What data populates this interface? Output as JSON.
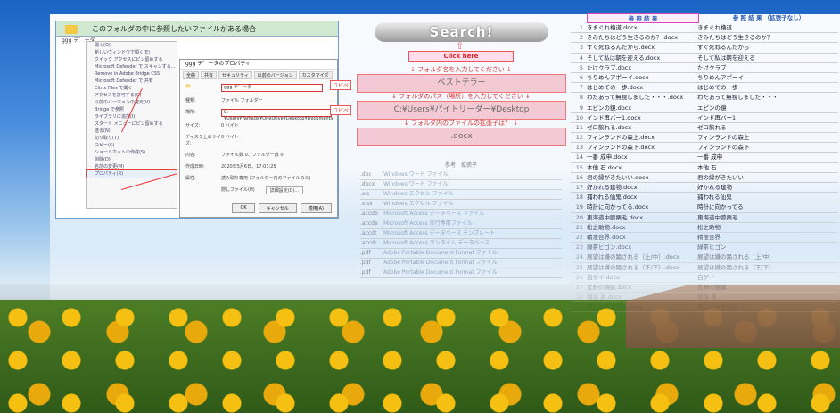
{
  "explorer": {
    "header": "このフォルダの中に参照したいファイルがある場合",
    "folder_label": "ggg テ゛ータ",
    "context_menu": [
      "開く(O)",
      "新しいウィンドウで開く(E)",
      "クイック アクセスにピン留めする",
      "Microsoft Defender で スキャンする...",
      "Remove in Adobe Bridge CS5",
      "Microsoft Defender で 共有",
      "Citrix Files で開く",
      "アクセスを許可する(G)",
      "以前のバージョンの復元(V)",
      "Bridge で参照",
      "ライブラリに追加(I)",
      "スタート メニューにピン留めする",
      "送る(N)",
      "切り取り(T)",
      "コピー(C)",
      "ショートカットの作成(S)",
      "削除(D)",
      "名前の変更(M)",
      "プロパティ(R)"
    ],
    "props_title": "ggg テ゛ータのプロパティ",
    "props_tabs": [
      "全般",
      "共有",
      "セキュリティ",
      "以前のバージョン",
      "カスタマイズ"
    ],
    "props_name": "ggg テ゛ータ",
    "props_rows": [
      {
        "k": "種類:",
        "v": "ファイル フォルダー"
      },
      {
        "k": "場所:",
        "v": "C:¥Users¥Yamada¥OneDrive¥Desktop¥Documents"
      },
      {
        "k": "サイズ:",
        "v": "0 バイト"
      },
      {
        "k": "ディスク上のサイズ:",
        "v": "0 バイト"
      },
      {
        "k": "内容:",
        "v": "ファイル数 0、フォルダー数 0"
      },
      {
        "k": "作成日時:",
        "v": "2020年5月6日、17:03:25"
      },
      {
        "k": "属性:",
        "v": "読み取り専用 (フォルダー内のファイルのみ)"
      }
    ],
    "props_hidden": "隠しファイル(H)",
    "props_detail": "詳細設定(D)...",
    "props_buttons": [
      "OK",
      "キャンセル",
      "適用(A)"
    ]
  },
  "center": {
    "search_label": "Search!",
    "click_here": "Click here",
    "hint1": "↓ フォルダ名を入力してください ↓",
    "input1": "ベストテラー",
    "hint2": "↓ フォルダのパス（場所）を入力してください ↓",
    "input2": "C:¥Users¥パイトリーダー¥Desktop",
    "hint3": "↓ フォルダ内のファイルの拡張子は？ ↓",
    "input3": ".docx",
    "copy_tag": "コピペ",
    "copy_tag2": "コピペ"
  },
  "ext_table": {
    "header": "参考：拡張子",
    "rows": [
      {
        "e": ".doc",
        "d": "Windows ワード ファイル"
      },
      {
        "e": ".docx",
        "d": "Windows ワード ファイル"
      },
      {
        "e": ".xls",
        "d": "Windows エクセル ファイル"
      },
      {
        "e": ".xlsx",
        "d": "Windows エクセル ファイル"
      },
      {
        "e": ".accdb",
        "d": "Microsoft Access データベース ファイル"
      },
      {
        "e": ".accde",
        "d": "Microsoft Access 実行専用ファイル"
      },
      {
        "e": ".accdt",
        "d": "Microsoft Access データベース テンプレート"
      },
      {
        "e": ".accdr",
        "d": "Microsoft Access ランタイム データベース"
      },
      {
        "e": ".pdf",
        "d": "Adobe Portable Document Format ファイル"
      },
      {
        "e": ".pdf",
        "d": "Adobe Portable Document Format ファイル"
      },
      {
        "e": ".pdf",
        "d": "Adobe Portable Document Format ファイル"
      }
    ]
  },
  "right_table": {
    "header_a": "参 照 結 果",
    "header_b": "参 照 結 果 （拡張子なし）",
    "rows": [
      {
        "n": "1",
        "a": "きまぐれ櫓道.docx",
        "b": "きまぐれ櫓道"
      },
      {
        "n": "2",
        "a": "きみたちはどう生きるのか？.docx",
        "b": "きみたちはどう生きるのか？"
      },
      {
        "n": "3",
        "a": "すぐ死ねるんだから.docx",
        "b": "すぐ死ねるんだから"
      },
      {
        "n": "4",
        "a": "そして私は朝を迎える.docx",
        "b": "そして私は朝を迎える"
      },
      {
        "n": "5",
        "a": "たけクラブ.docx",
        "b": "たけクラブ"
      },
      {
        "n": "6",
        "a": "ちりめんアポーイ.docx",
        "b": "ちりめんアポーイ"
      },
      {
        "n": "7",
        "a": "はじめての一歩.docx",
        "b": "はじめての一歩"
      },
      {
        "n": "8",
        "a": "わだあって無視しました・・・.docx",
        "b": "わだあって無視しました・・・"
      },
      {
        "n": "9",
        "a": "エピンの鏡.docx",
        "b": "エピンの鏡"
      },
      {
        "n": "10",
        "a": "インド再バー1.docx",
        "b": "インド再バー1"
      },
      {
        "n": "11",
        "a": "ゼロ飲れる.docx",
        "b": "ゼロ飲れる"
      },
      {
        "n": "12",
        "a": "フィンランドの森上.docx",
        "b": "フィンランドの森上"
      },
      {
        "n": "13",
        "a": "フィンランドの森下.docx",
        "b": "フィンランドの森下"
      },
      {
        "n": "14",
        "a": "一番 成申.docx",
        "b": "一番 成申"
      },
      {
        "n": "15",
        "a": "本他 石.docx",
        "b": "本他 石"
      },
      {
        "n": "16",
        "a": "君の縁がきたいい.docx",
        "b": "君の縁がきたいい"
      },
      {
        "n": "17",
        "a": "好かれる建物.docx",
        "b": "好かれる建物"
      },
      {
        "n": "18",
        "a": "捕われる仙鬼.docx",
        "b": "捕われる仙鬼"
      },
      {
        "n": "19",
        "a": "時計に向かってる.docx",
        "b": "時計に向かってる"
      },
      {
        "n": "20",
        "a": "東海道中膝栗毛.docx",
        "b": "東海道中膝栗毛"
      },
      {
        "n": "21",
        "a": "松之助物.docx",
        "b": "松之助物"
      },
      {
        "n": "22",
        "a": "精准合界.docx",
        "b": "精准合界"
      },
      {
        "n": "23",
        "a": "緑茶ヒゴン.docx",
        "b": "緑茶ヒゴン"
      },
      {
        "n": "24",
        "a": "展望は嫌の踊される（上/中）.docx",
        "b": "展望は嫌の踊される（上/中）"
      },
      {
        "n": "25",
        "a": "展望は嫌の踊される（下/下）.docx",
        "b": "展望は嫌の踊される（下/下）"
      },
      {
        "n": "26",
        "a": "白ゲイ.docx",
        "b": "白ゲイ"
      },
      {
        "n": "27",
        "a": "荒野の鏡鍵.docx",
        "b": "荒野の鏡鍵"
      },
      {
        "n": "28",
        "a": "頭嶺 真.docx",
        "b": "頭嶺 真"
      },
      {
        "n": "29",
        "a": "第二のままの性.docx",
        "b": "第二のままの性"
      }
    ]
  }
}
